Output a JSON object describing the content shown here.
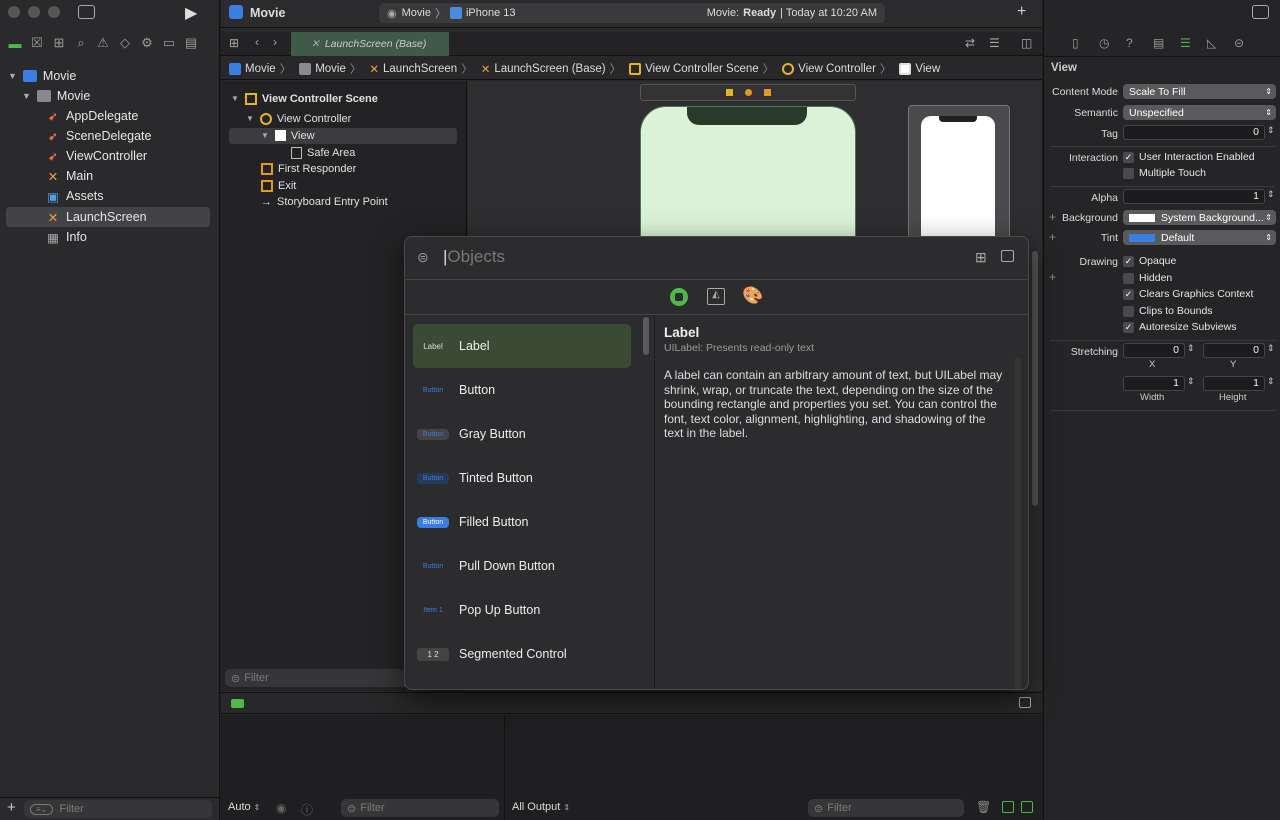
{
  "window": {
    "scheme_target": "Movie",
    "device": "iPhone 13",
    "project_name": "Movie",
    "status_prefix": "Movie:",
    "status_state": "Ready",
    "status_time": "| Today at 10:20 AM"
  },
  "navigator": {
    "root": "Movie",
    "group": "Movie",
    "files": [
      {
        "name": "AppDelegate",
        "kind": "swift"
      },
      {
        "name": "SceneDelegate",
        "kind": "swift"
      },
      {
        "name": "ViewController",
        "kind": "swift"
      },
      {
        "name": "Main",
        "kind": "storyboard"
      },
      {
        "name": "Assets",
        "kind": "assets"
      },
      {
        "name": "LaunchScreen",
        "kind": "storyboard",
        "selected": true
      },
      {
        "name": "Info",
        "kind": "plist"
      }
    ],
    "filter_placeholder": "Filter"
  },
  "tab": {
    "label": "LaunchScreen (Base)"
  },
  "breadcrumbs": [
    "Movie",
    "Movie",
    "LaunchScreen",
    "LaunchScreen (Base)",
    "View Controller Scene",
    "View Controller",
    "View"
  ],
  "outline": {
    "scene": "View Controller Scene",
    "controller": "View Controller",
    "view": "View",
    "safe_area": "Safe Area",
    "first_responder": "First Responder",
    "exit": "Exit",
    "entry": "Storyboard Entry Point",
    "filter_placeholder": "Filter"
  },
  "library": {
    "search_placeholder": "Objects",
    "items": [
      {
        "name": "Label",
        "thumb": "Label"
      },
      {
        "name": "Button",
        "thumb": "Button"
      },
      {
        "name": "Gray Button",
        "thumb": "Button"
      },
      {
        "name": "Tinted Button",
        "thumb": "Button"
      },
      {
        "name": "Filled Button",
        "thumb": "Button"
      },
      {
        "name": "Pull Down Button",
        "thumb": "Button"
      },
      {
        "name": "Pop Up Button",
        "thumb": "Item 1"
      },
      {
        "name": "Segmented Control",
        "thumb": "1 2"
      }
    ],
    "detail_title": "Label",
    "detail_subtitle": "UILabel: Presents read-only text",
    "detail_body": "A label can contain an arbitrary amount of text, but UILabel may shrink, wrap, or truncate the text, depending on the size of the bounding rectangle and properties you set. You can control the font, text color, alignment, highlighting, and shadowing of the text in the label."
  },
  "debug": {
    "auto_label": "Auto",
    "filter_placeholder": "Filter",
    "output_label": "All Output",
    "filter2_placeholder": "Filter"
  },
  "inspector": {
    "section": "View",
    "content_mode_label": "Content Mode",
    "content_mode": "Scale To Fill",
    "semantic_label": "Semantic",
    "semantic": "Unspecified",
    "tag_label": "Tag",
    "tag": "0",
    "interaction_label": "Interaction",
    "user_interaction": "User Interaction Enabled",
    "multiple_touch": "Multiple Touch",
    "alpha_label": "Alpha",
    "alpha": "1",
    "background_label": "Background",
    "background": "System Background...",
    "tint_label": "Tint",
    "tint": "Default",
    "drawing_label": "Drawing",
    "opaque": "Opaque",
    "hidden": "Hidden",
    "clears": "Clears Graphics Context",
    "clips": "Clips to Bounds",
    "autoresize": "Autoresize Subviews",
    "stretching_label": "Stretching",
    "sx": "0",
    "sy": "0",
    "sw": "1",
    "sh": "1",
    "x_label": "X",
    "y_label": "Y",
    "w_label": "Width",
    "h_label": "Height"
  },
  "colors": {
    "accent": "#3b7de0",
    "selected_item": "#3a4a34",
    "library_green": "#4fb84a"
  }
}
